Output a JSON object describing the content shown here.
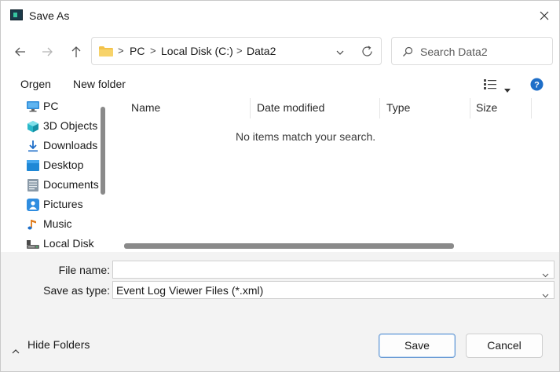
{
  "window": {
    "title": "Save As"
  },
  "nav": {
    "breadcrumbs": [
      "PC",
      "Local Disk (C:)",
      "Data2"
    ],
    "separator": ">",
    "search_placeholder": "Search Data2"
  },
  "commands": {
    "organize": "Orgen",
    "new_folder": "New folder"
  },
  "sidebar": {
    "items": [
      {
        "label": "PC",
        "icon": "pc-icon"
      },
      {
        "label": "3D Objects",
        "icon": "3d-objects-icon"
      },
      {
        "label": "Downloads",
        "icon": "download-icon"
      },
      {
        "label": "Desktop",
        "icon": "desktop-icon"
      },
      {
        "label": "Documents",
        "icon": "documents-icon"
      },
      {
        "label": "Pictures",
        "icon": "pictures-icon"
      },
      {
        "label": "Music",
        "icon": "music-icon"
      },
      {
        "label": "Local Disk",
        "icon": "local-disk-icon"
      }
    ]
  },
  "list": {
    "columns": [
      "Name",
      "Date modified",
      "Type",
      "Size"
    ],
    "empty_message": "No items match your search."
  },
  "form": {
    "file_name_label": "File name:",
    "file_name_value": "",
    "save_type_label": "Save as type:",
    "save_type_value": "Event Log Viewer Files (*.xml)"
  },
  "footer": {
    "hide_folders": "Hide Folders",
    "save": "Save",
    "cancel": "Cancel"
  },
  "colors": {
    "accent": "#1e6ec8",
    "folder": "#f3c24a",
    "primary_border": "#6a9bd4"
  }
}
